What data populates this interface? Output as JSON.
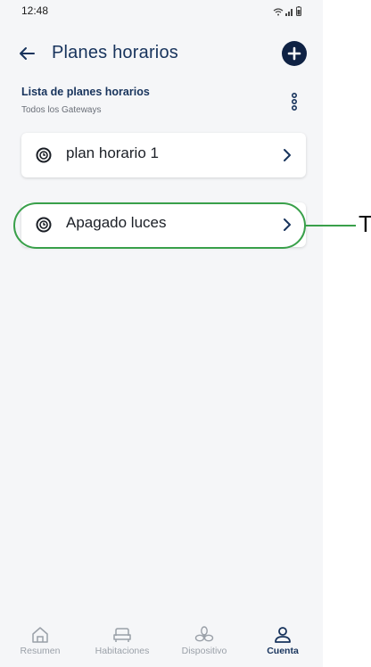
{
  "status_bar": {
    "time": "12:48"
  },
  "header": {
    "title": "Planes horarios"
  },
  "list": {
    "title": "Lista de planes horarios",
    "subtitle": "Todos los Gateways"
  },
  "schedules": [
    {
      "label": "plan horario 1"
    },
    {
      "label": "Apagado luces"
    }
  ],
  "callout": {
    "letter": "T"
  },
  "tabs": [
    {
      "label": "Resumen"
    },
    {
      "label": "Habitaciones"
    },
    {
      "label": "Dispositivo"
    },
    {
      "label": "Cuenta"
    }
  ],
  "colors": {
    "primary": "#17335c",
    "highlight": "#39a04a",
    "background": "#f5f6f8"
  }
}
